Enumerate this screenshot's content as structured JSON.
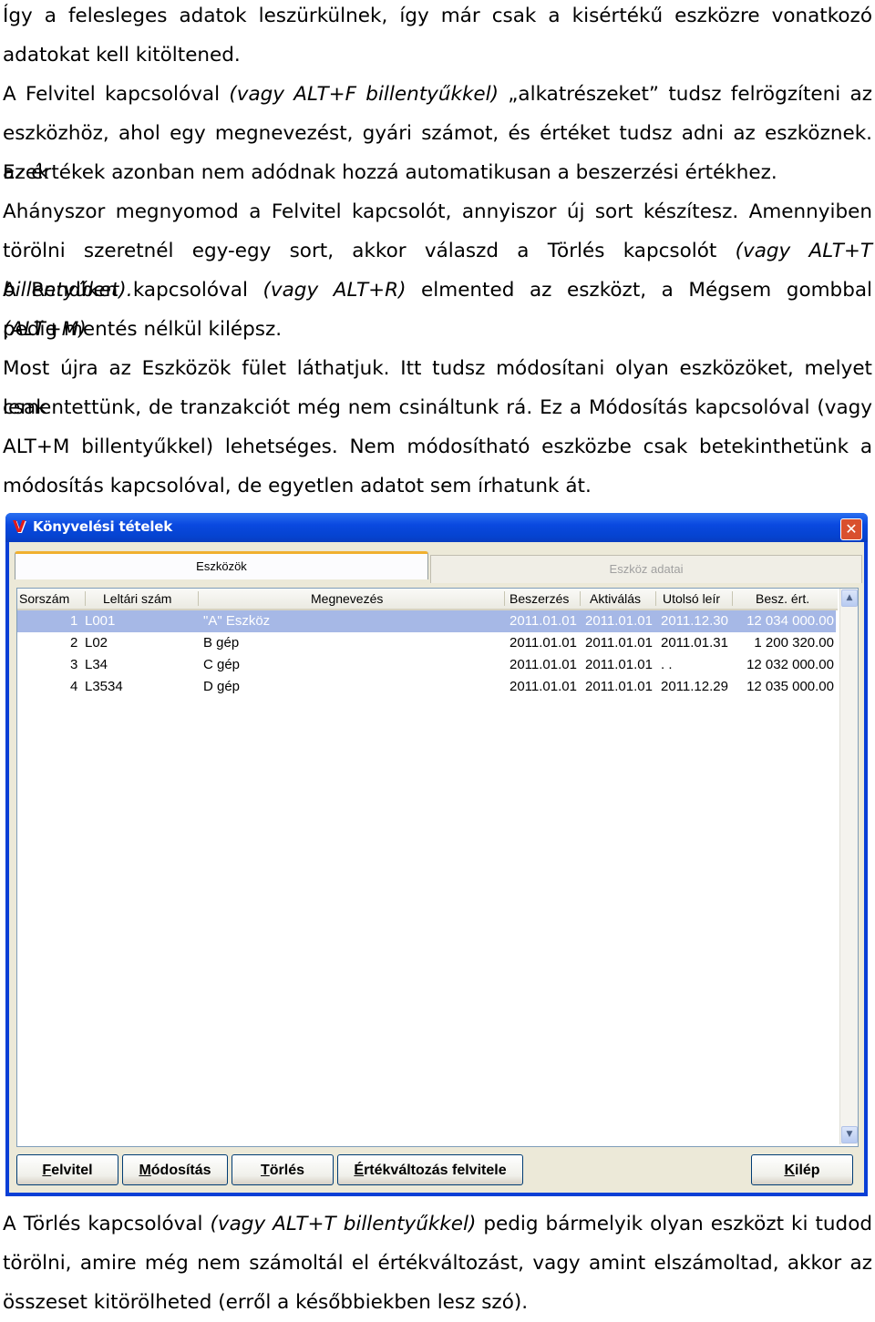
{
  "text_top": {
    "p1_a": "Így a felesleges adatok leszürkülnek, így már csak a kisértékű eszközre vonatkozó",
    "p1_b": "adatokat kell kitöltened.",
    "p2_a1": "A Felvitel kapcsolóval ",
    "p2_a2": "(vagy ALT+F billentyűkkel)",
    "p2_a3": " „alkatrészeket” tudsz felrögzíteni az",
    "p2_b": "eszközhöz, ahol egy megnevezést, gyári számot, és értéket tudsz adni az eszköznek. Ezek",
    "p2_c": "az értékek azonban nem adódnak hozzá automatikusan a beszerzési értékhez.",
    "p3_a": "Ahányszor megnyomod a Felvitel kapcsolót, annyiszor új sort készítesz. Amennyiben",
    "p3_b1": "törölni szeretnél egy-egy sort, akkor válaszd a Törlés kapcsolót ",
    "p3_b2": "(vagy ALT+T billentyűket).",
    "p4_a1": "A Rendben kapcsolóval ",
    "p4_a2": "(vagy ALT+R)",
    "p4_a3": " elmented az eszközt, a Mégsem gombbal ",
    "p4_a4": "(ALT+M)",
    "p4_b": "pedig mentés nélkül kilépsz.",
    "p5_a": "Most újra az Eszközök fület láthatjuk. Itt tudsz módosítani olyan eszközöket, melyet csak",
    "p5_b": "lementettünk, de tranzakciót még nem csináltunk rá. Ez a Módosítás kapcsolóval (vagy",
    "p5_c": "ALT+M billentyűkkel) lehetséges. Nem módosítható eszközbe csak betekinthetünk a",
    "p5_d": "módosítás kapcsolóval, de egyetlen adatot sem írhatunk át."
  },
  "window": {
    "title": "Könyvelési tételek",
    "close_glyph": "✕",
    "logo_glyph": "V",
    "tabs": {
      "active": "Eszközök",
      "inactive": "Eszköz adatai"
    },
    "columns": [
      "Sorszám",
      "Leltári szám",
      "Megnevezés",
      "Beszerzés",
      "Aktiválás",
      "Utolsó leír",
      "Besz. ért."
    ],
    "rows": [
      {
        "n": "1",
        "code": "L001",
        "name": "\"A\" Eszköz",
        "besz": "2011.01.01",
        "akt": "2011.01.01",
        "utolso": "2011.12.30",
        "ert": "12 034 000.00"
      },
      {
        "n": "2",
        "code": "L02",
        "name": "B gép",
        "besz": "2011.01.01",
        "akt": "2011.01.01",
        "utolso": "2011.01.31",
        "ert": "1 200 320.00"
      },
      {
        "n": "3",
        "code": "L34",
        "name": "C gép",
        "besz": "2011.01.01",
        "akt": "2011.01.01",
        "utolso": ". .",
        "ert": "12 032 000.00"
      },
      {
        "n": "4",
        "code": "L3534",
        "name": "D gép",
        "besz": "2011.01.01",
        "akt": "2011.01.01",
        "utolso": "2011.12.29",
        "ert": "12 035 000.00"
      }
    ],
    "scroll_up": "▲",
    "scroll_down": "▼",
    "buttons": {
      "felvitel_key": "F",
      "felvitel_rest": "elvitel",
      "modositas_key": "M",
      "modositas_rest": "ódosítás",
      "torles_key": "T",
      "torles_rest": "örlés",
      "ertek_key": "É",
      "ertek_rest": "rtékváltozás felvitele",
      "kilep_key": "K",
      "kilep_rest": "ilép"
    }
  },
  "text_bottom": {
    "p6_a1": "A Törlés kapcsolóval ",
    "p6_a2": "(vagy ALT+T billentyűkkel)",
    "p6_a3": " pedig bármelyik olyan eszközt ki tudod",
    "p6_b": "törölni, amire még nem számoltál el értékváltozást, vagy amint elszámoltad, akkor az",
    "p6_c": "összeset kitörölheted (erről a későbbiekben lesz szó)."
  }
}
